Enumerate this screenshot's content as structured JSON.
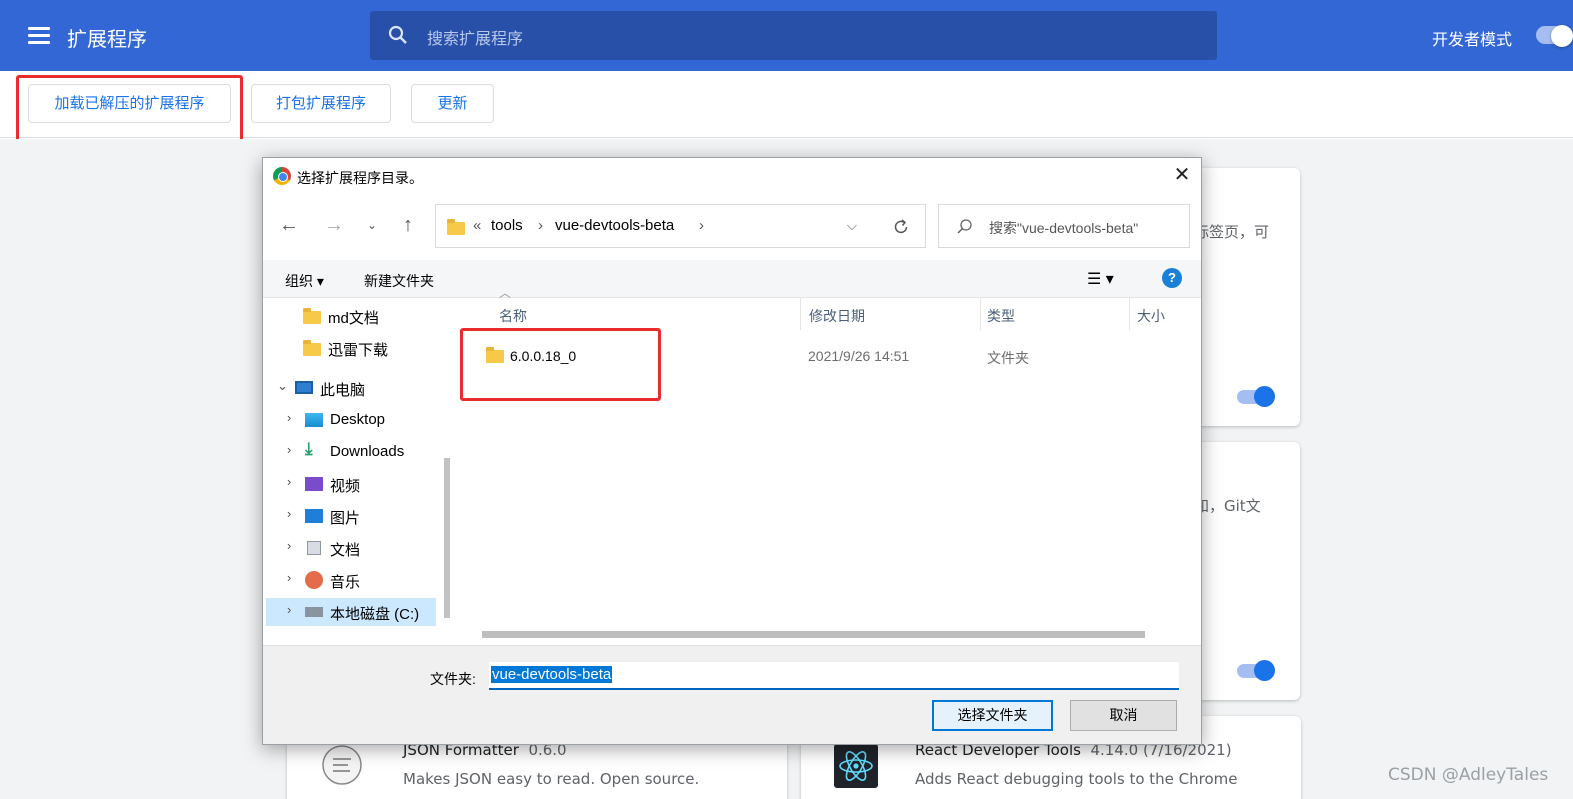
{
  "header": {
    "title": "扩展程序",
    "search_placeholder": "搜索扩展程序",
    "dev_mode_label": "开发者模式"
  },
  "toolbar": {
    "load_unpacked": "加载已解压的扩展程序",
    "pack": "打包扩展程序",
    "update": "更新"
  },
  "cards": {
    "card1_snippet": "标签页，可",
    "card2_snippet": "知，Git文",
    "card3": {
      "name": "JSON Formatter",
      "version": "0.6.0",
      "desc": "Makes JSON easy to read. Open source."
    },
    "card4": {
      "name": "React Developer Tools",
      "version": "4.14.0 (7/16/2021)",
      "desc": "Adds React debugging tools to the Chrome"
    }
  },
  "watermark": "CSDN @AdleyTales",
  "dialog": {
    "title": "选择扩展程序目录。",
    "address": {
      "prefix": "«",
      "segments": [
        "tools",
        "vue-devtools-beta"
      ],
      "sep": "›"
    },
    "search_placeholder": "搜索\"vue-devtools-beta\"",
    "organize": "组织 ▾",
    "new_folder": "新建文件夹",
    "help": "?",
    "nav": [
      {
        "label": "md文档",
        "icon": "folder-icon"
      },
      {
        "label": "迅雷下载",
        "icon": "folder-icon"
      },
      {
        "label": "此电脑",
        "icon": "computer-icon",
        "expanded": true
      },
      {
        "label": "Desktop",
        "icon": "desktop-icon"
      },
      {
        "label": "Downloads",
        "icon": "download-icon"
      },
      {
        "label": "视频",
        "icon": "video-icon"
      },
      {
        "label": "图片",
        "icon": "picture-icon"
      },
      {
        "label": "文档",
        "icon": "document-icon"
      },
      {
        "label": "音乐",
        "icon": "music-icon"
      },
      {
        "label": "本地磁盘 (C:)",
        "icon": "drive-icon",
        "selected": true
      }
    ],
    "columns": {
      "name": "名称",
      "modified": "修改日期",
      "type": "类型",
      "size": "大小"
    },
    "files": [
      {
        "name": "6.0.0.18_0",
        "modified": "2021/9/26 14:51",
        "type": "文件夹"
      }
    ],
    "folder_label": "文件夹:",
    "folder_value": "vue-devtools-beta",
    "select_button": "选择文件夹",
    "cancel_button": "取消"
  },
  "colors": {
    "chrome_blue": "#3367d6",
    "accent": "#1a73e8",
    "highlight_red": "#ea2c2c"
  }
}
